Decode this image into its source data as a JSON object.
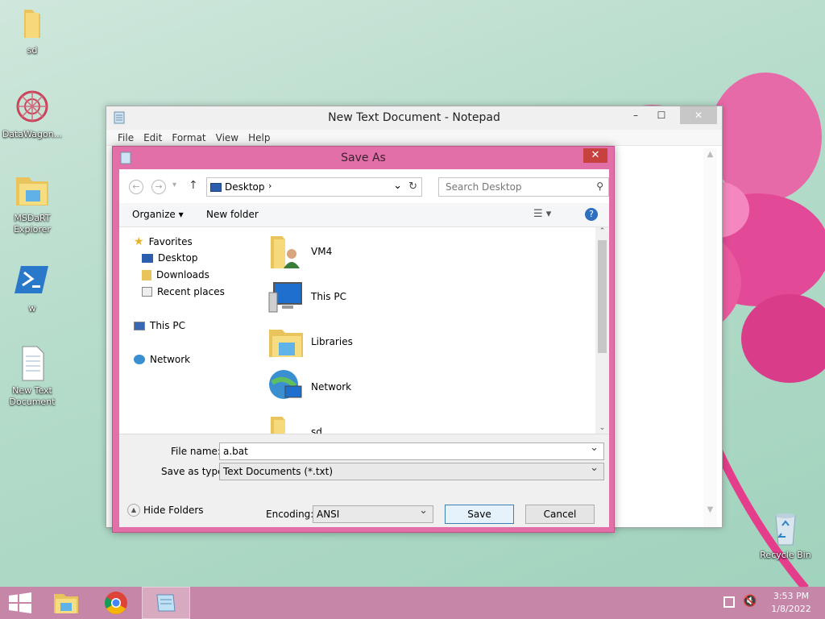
{
  "desktop": {
    "icons": [
      {
        "label": "sd",
        "icon": "folder-icon"
      },
      {
        "label": "DataWagon...",
        "icon": "datawagon-app-icon"
      },
      {
        "label": "MSDaRT Explorer",
        "icon": "folder-shortcut-icon"
      },
      {
        "label": "w",
        "icon": "powershell-icon"
      },
      {
        "label": "New Text Document",
        "icon": "text-file-icon"
      },
      {
        "label": "Recycle Bin",
        "icon": "recycle-bin-icon"
      }
    ]
  },
  "notepad": {
    "title": "New Text Document - Notepad",
    "menu": [
      "File",
      "Edit",
      "Format",
      "View",
      "Help"
    ]
  },
  "saveas": {
    "title": "Save As",
    "address": "Desktop",
    "search_placeholder": "Search Desktop",
    "organize": "Organize",
    "new_folder": "New folder",
    "tree": {
      "favorites": "Favorites",
      "desktop": "Desktop",
      "downloads": "Downloads",
      "recent": "Recent places",
      "thispc": "This PC",
      "network": "Network"
    },
    "files": [
      "VM4",
      "This PC",
      "Libraries",
      "Network",
      "sd"
    ],
    "filename_label": "File name:",
    "filename_value": "a.bat",
    "type_label": "Save as type:",
    "type_value": "Text Documents (*.txt)",
    "hide_folders": "Hide Folders",
    "encoding_label": "Encoding:",
    "encoding_value": "ANSI",
    "save": "Save",
    "cancel": "Cancel"
  },
  "taskbar": {
    "time": "3:53 PM",
    "date": "1/8/2022"
  },
  "colors": {
    "accent": "#e36fa8",
    "close": "#c7423f",
    "taskbar": "#c782a6"
  }
}
